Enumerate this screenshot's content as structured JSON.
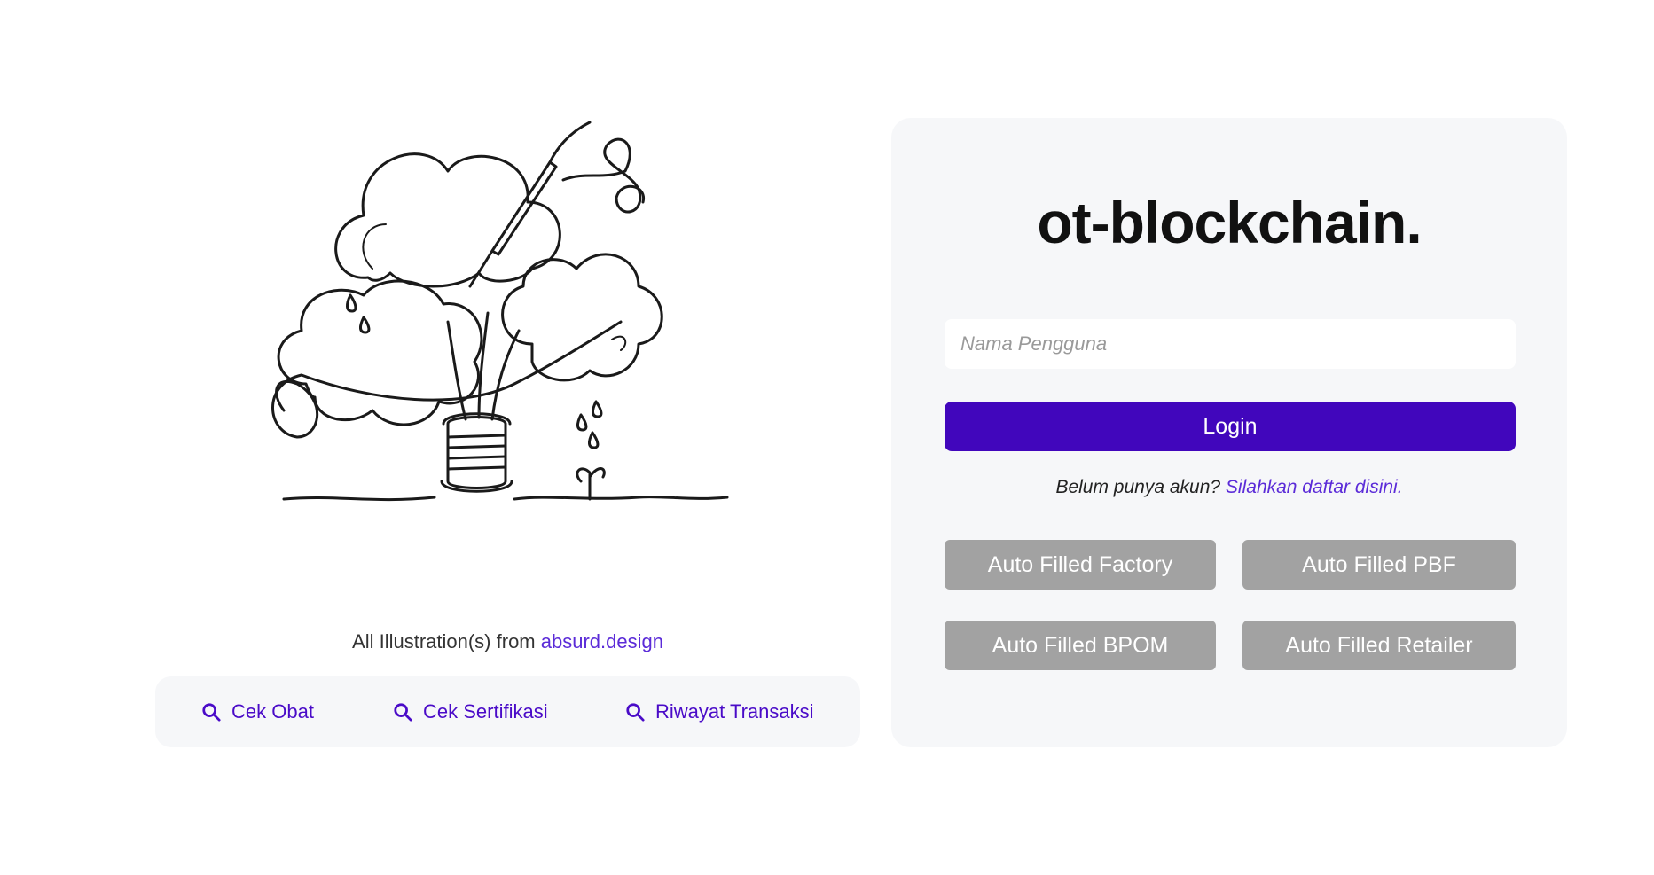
{
  "illustration": {
    "credit_prefix": "All Illustration(s) from",
    "credit_link": "absurd.design"
  },
  "quick_links": [
    {
      "label": "Cek Obat",
      "icon": "search-icon"
    },
    {
      "label": "Cek Sertifikasi",
      "icon": "search-icon"
    },
    {
      "label": "Riwayat Transaksi",
      "icon": "search-icon"
    }
  ],
  "login": {
    "brand": "ot-blockchain.",
    "username_placeholder": "Nama Pengguna",
    "username_value": "",
    "login_label": "Login",
    "register_prompt": "Belum punya akun?",
    "register_link": "Silahkan daftar disini.",
    "auto_fill": [
      {
        "label": "Auto Filled Factory"
      },
      {
        "label": "Auto Filled PBF"
      },
      {
        "label": "Auto Filled BPOM"
      },
      {
        "label": "Auto Filled Retailer"
      }
    ]
  },
  "colors": {
    "accent": "#4106bc",
    "link": "#5b2bd8",
    "panel_bg": "#f6f7f9",
    "auto_btn": "#a2a2a2"
  }
}
